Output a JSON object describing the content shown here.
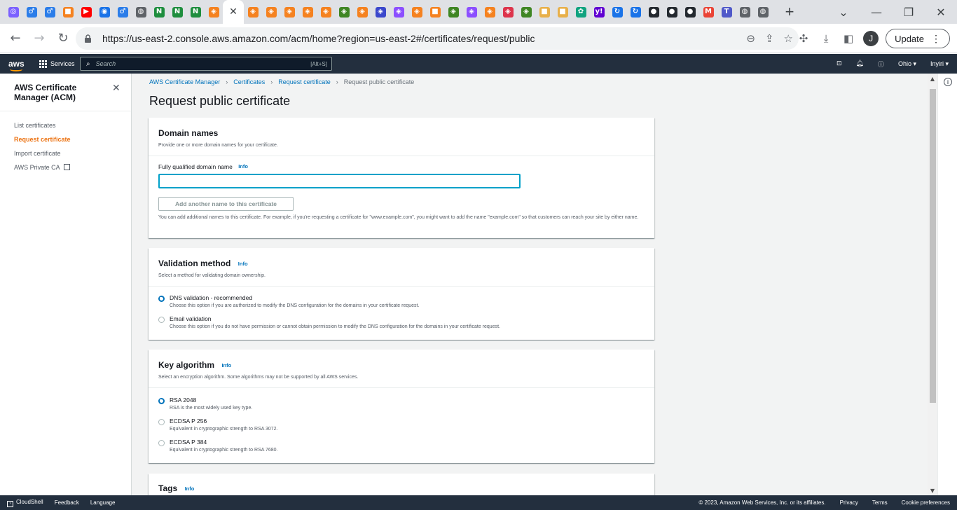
{
  "browser": {
    "tabs": [
      {
        "icon": "gallery-icon",
        "glyph": "◎",
        "color": "#7b61ff"
      },
      {
        "icon": "fork-icon",
        "glyph": "♂",
        "color": "#2b7de9"
      },
      {
        "icon": "fork-icon",
        "glyph": "♂",
        "color": "#2b7de9"
      },
      {
        "icon": "box-icon",
        "glyph": "■",
        "color": "#f58220"
      },
      {
        "icon": "youtube-icon",
        "glyph": "▶",
        "color": "#ff0000"
      },
      {
        "icon": "location-pin-icon",
        "glyph": "◉",
        "color": "#1a73e8"
      },
      {
        "icon": "fork-icon",
        "glyph": "♂",
        "color": "#2b7de9"
      },
      {
        "icon": "globe-icon",
        "glyph": "◍",
        "color": "#5f6368"
      },
      {
        "icon": "notion-n-icon",
        "glyph": "N",
        "color": "#1e8e3e"
      },
      {
        "icon": "notion-n-icon",
        "glyph": "N",
        "color": "#1e8e3e"
      },
      {
        "icon": "notion-n-icon",
        "glyph": "N",
        "color": "#1e8e3e"
      },
      {
        "icon": "aws-service-icon",
        "glyph": "◈",
        "color": "#f58220"
      },
      {
        "icon": "close-icon",
        "glyph": "✕",
        "color": "#ffffff",
        "active": true
      },
      {
        "icon": "aws-service-icon",
        "glyph": "◈",
        "color": "#f58220"
      },
      {
        "icon": "aws-service-icon",
        "glyph": "◈",
        "color": "#f58220"
      },
      {
        "icon": "aws-service-icon",
        "glyph": "◈",
        "color": "#f58220"
      },
      {
        "icon": "aws-service-icon",
        "glyph": "◈",
        "color": "#f58220"
      },
      {
        "icon": "aws-service-icon",
        "glyph": "◈",
        "color": "#f58220"
      },
      {
        "icon": "aws-green-service-icon",
        "glyph": "◈",
        "color": "#3f8624"
      },
      {
        "icon": "aws-service-icon",
        "glyph": "◈",
        "color": "#f58220"
      },
      {
        "icon": "aws-blue-service-icon",
        "glyph": "◈",
        "color": "#3b48cc"
      },
      {
        "icon": "aws-purple-service-icon",
        "glyph": "◈",
        "color": "#8c4fff"
      },
      {
        "icon": "aws-service-icon",
        "glyph": "◈",
        "color": "#f58220"
      },
      {
        "icon": "cube-icon",
        "glyph": "■",
        "color": "#f58220"
      },
      {
        "icon": "aws-green-service-icon",
        "glyph": "◈",
        "color": "#3f8624"
      },
      {
        "icon": "aws-purple-service-icon",
        "glyph": "◈",
        "color": "#8c4fff"
      },
      {
        "icon": "aws-service-icon",
        "glyph": "◈",
        "color": "#f58220"
      },
      {
        "icon": "aws-red-service-icon",
        "glyph": "◈",
        "color": "#dd344c"
      },
      {
        "icon": "aws-green-service-icon",
        "glyph": "◈",
        "color": "#3f8624"
      },
      {
        "icon": "cube-icon",
        "glyph": "■",
        "color": "#e8b04a"
      },
      {
        "icon": "cube-icon",
        "glyph": "■",
        "color": "#e8b04a"
      },
      {
        "icon": "chatgpt-icon",
        "glyph": "✿",
        "color": "#10a37f"
      },
      {
        "icon": "yahoo-icon",
        "glyph": "y!",
        "color": "#6001d2"
      },
      {
        "icon": "sync-icon",
        "glyph": "↻",
        "color": "#1a73e8"
      },
      {
        "icon": "sync-icon",
        "glyph": "↻",
        "color": "#1a73e8"
      },
      {
        "icon": "github-icon",
        "glyph": "●",
        "color": "#24292f"
      },
      {
        "icon": "github-icon",
        "glyph": "●",
        "color": "#24292f"
      },
      {
        "icon": "github-icon",
        "glyph": "●",
        "color": "#24292f"
      },
      {
        "icon": "gmail-icon",
        "glyph": "M",
        "color": "#ea4335"
      },
      {
        "icon": "teams-icon",
        "glyph": "T",
        "color": "#5059c9"
      },
      {
        "icon": "globe-icon",
        "glyph": "◍",
        "color": "#5f6368"
      },
      {
        "icon": "globe-icon",
        "glyph": "◍",
        "color": "#5f6368"
      }
    ],
    "url": "https://us-east-2.console.aws.amazon.com/acm/home?region=us-east-2#/certificates/request/public",
    "avatar_letter": "J",
    "update_label": "Update"
  },
  "aws_nav": {
    "logo": "aws",
    "services_label": "Services",
    "search_placeholder": "Search",
    "search_shortcut": "[Alt+S]",
    "region": "Ohio ▾",
    "account": "Inyiri ▾"
  },
  "sidenav": {
    "title": "AWS Certificate Manager (ACM)",
    "items": [
      {
        "label": "List certificates",
        "active": false
      },
      {
        "label": "Request certificate",
        "active": true
      },
      {
        "label": "Import certificate",
        "active": false
      },
      {
        "label": "AWS Private CA",
        "active": false,
        "external": true
      }
    ]
  },
  "breadcrumb": {
    "items": [
      "AWS Certificate Manager",
      "Certificates",
      "Request certificate"
    ],
    "current": "Request public certificate"
  },
  "page_title": "Request public certificate",
  "domain_panel": {
    "title": "Domain names",
    "description": "Provide one or more domain names for your certificate.",
    "field_label": "Fully qualified domain name",
    "info": "Info",
    "input_value": "",
    "add_button": "Add another name to this certificate",
    "hint": "You can add additional names to this certificate. For example, if you're requesting a certificate for \"www.example.com\", you might want to add the name \"example.com\" so that customers can reach your site by either name."
  },
  "validation_panel": {
    "title": "Validation method",
    "info": "Info",
    "description": "Select a method for validating domain ownership.",
    "options": [
      {
        "label": "DNS validation - recommended",
        "desc": "Choose this option if you are authorized to modify the DNS configuration for the domains in your certificate request.",
        "checked": true
      },
      {
        "label": "Email validation",
        "desc": "Choose this option if you do not have permission or cannot obtain permission to modify the DNS configuration for the domains in your certificate request.",
        "checked": false
      }
    ]
  },
  "key_panel": {
    "title": "Key algorithm",
    "info": "Info",
    "description": "Select an encryption algorithm. Some algorithms may not be supported by all AWS services.",
    "options": [
      {
        "label": "RSA 2048",
        "desc": "RSA is the most widely used key type.",
        "checked": true
      },
      {
        "label": "ECDSA P 256",
        "desc": "Equivalent in cryptographic strength to RSA 3072.",
        "checked": false
      },
      {
        "label": "ECDSA P 384",
        "desc": "Equivalent in cryptographic strength to RSA 7680.",
        "checked": false
      }
    ]
  },
  "tags_panel": {
    "title": "Tags",
    "info": "Info"
  },
  "footer": {
    "cloudshell": "CloudShell",
    "feedback": "Feedback",
    "language": "Language",
    "copyright": "© 2023, Amazon Web Services, Inc. or its affiliates.",
    "privacy": "Privacy",
    "terms": "Terms",
    "cookies": "Cookie preferences"
  }
}
